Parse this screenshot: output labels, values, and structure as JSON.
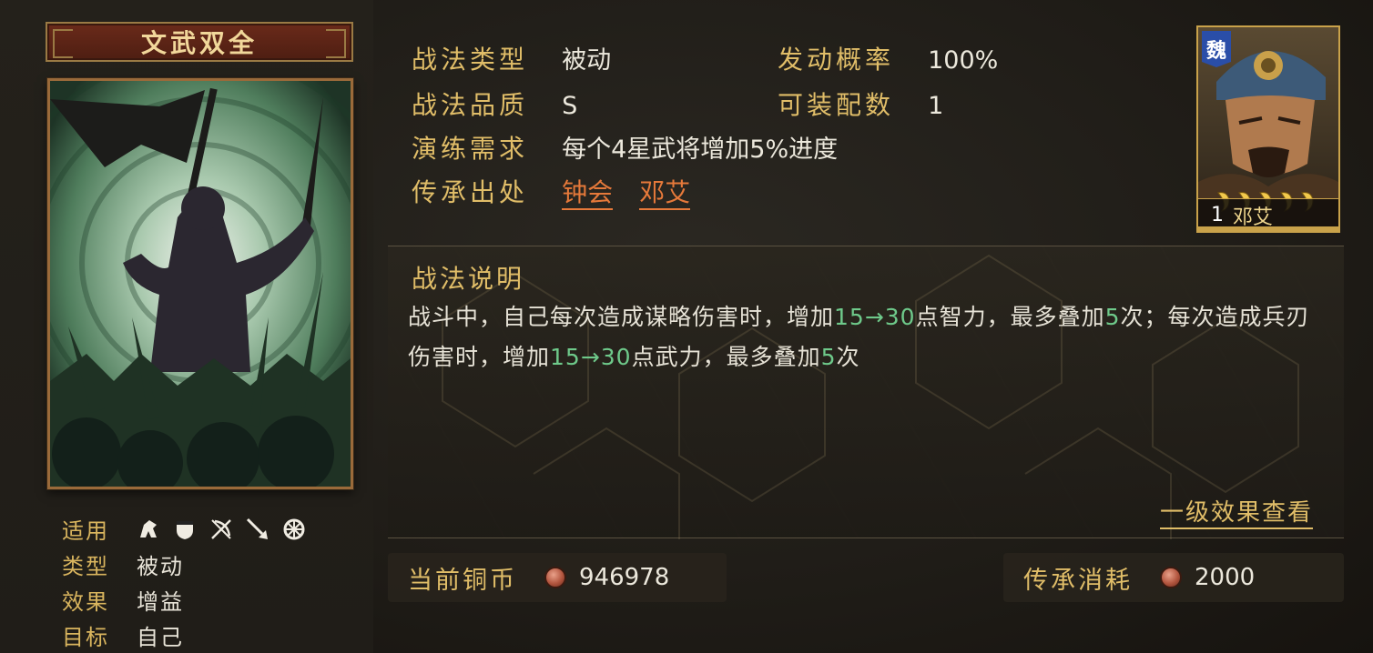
{
  "skill": {
    "name": "文武双全"
  },
  "left_attributes": [
    {
      "key": "适用",
      "value": ""
    },
    {
      "key": "类型",
      "value": "被动"
    },
    {
      "key": "效果",
      "value": "增益"
    },
    {
      "key": "目标",
      "value": "自己"
    }
  ],
  "troop_icons": [
    "cavalry-icon",
    "shield-icon",
    "bow-icon",
    "spear-icon",
    "vehicle-icon"
  ],
  "info": {
    "type_label": "战法类型",
    "type_value": "被动",
    "rate_label": "发动概率",
    "rate_value": "100%",
    "quality_label": "战法品质",
    "quality_value": "S",
    "equip_label": "可装配数",
    "equip_value": "1",
    "train_label": "演练需求",
    "train_value": "每个4星武将增加5%进度",
    "source_label": "传承出处",
    "sources": [
      "钟会",
      "邓艾"
    ]
  },
  "general": {
    "faction": "魏",
    "level": "1",
    "name": "邓艾",
    "stars": 5
  },
  "description": {
    "title": "战法说明",
    "part1": "战斗中，自己每次造成谋略伤害时，增加",
    "hl1": "15→30",
    "part2": "点智力，最多叠加",
    "hl2": "5",
    "part3": "次；每次造成兵刃伤害时，增加",
    "hl3": "15→30",
    "part4": "点武力，最多叠加",
    "hl4": "5",
    "part5": "次",
    "level_link": "一级效果查看"
  },
  "currency": {
    "current_label": "当前铜币",
    "current_value": "946978",
    "cost_label": "传承消耗",
    "cost_value": "2000"
  },
  "colors": {
    "gold": "#e0bd68",
    "highlight_green": "#6ec98a",
    "link_orange": "#e6793a",
    "faction_blue": "#2a4ea8"
  }
}
